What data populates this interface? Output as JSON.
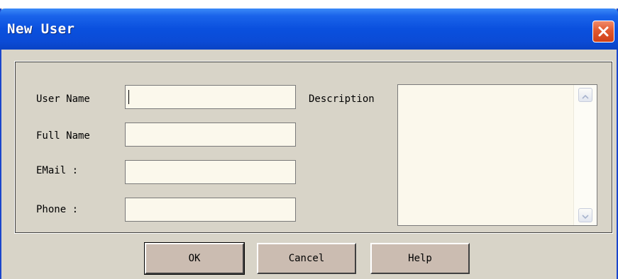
{
  "window": {
    "title": "New User",
    "close_icon": "close-icon"
  },
  "form": {
    "user_name_label": "User Name",
    "user_name_value": "",
    "full_name_label": "Full Name",
    "full_name_value": "",
    "email_label": "EMail :",
    "email_value": "",
    "phone_label": "Phone :",
    "phone_value": "",
    "description_label": "Description",
    "description_value": ""
  },
  "buttons": {
    "ok_label": "OK",
    "cancel_label": "Cancel",
    "help_label": "Help"
  },
  "colors": {
    "titlebar": "#0a50de",
    "dialog_bg": "#d8d4c8",
    "field_bg": "#fbf8ec",
    "button_bg": "#cbbcb1",
    "close_button": "#e1592f"
  }
}
